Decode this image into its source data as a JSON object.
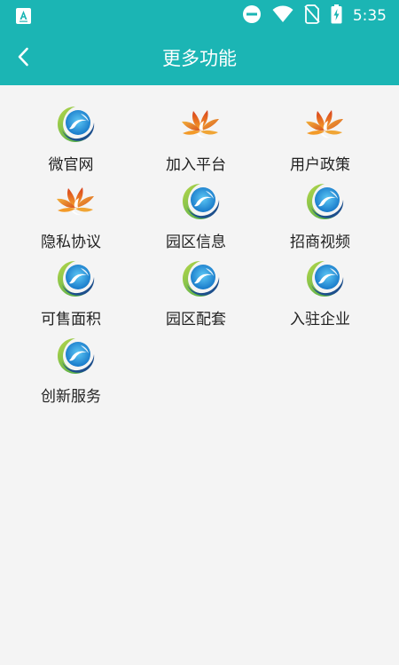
{
  "status_bar": {
    "time": "5:35",
    "icons": [
      "app-notification-icon",
      "do-not-disturb-icon",
      "wifi-icon",
      "no-sim-icon",
      "battery-charging-icon"
    ]
  },
  "header": {
    "title": "更多功能",
    "back_icon": "chevron-left-icon",
    "background_color": "#1bb5b4"
  },
  "features": [
    {
      "label": "微官网",
      "icon": "blue-swirl-logo-icon"
    },
    {
      "label": "加入平台",
      "icon": "orange-flower-logo-icon"
    },
    {
      "label": "用户政策",
      "icon": "orange-flower-logo-icon"
    },
    {
      "label": "隐私协议",
      "icon": "orange-flower-logo-icon"
    },
    {
      "label": "园区信息",
      "icon": "blue-swirl-logo-icon"
    },
    {
      "label": "招商视频",
      "icon": "blue-swirl-logo-icon"
    },
    {
      "label": "可售面积",
      "icon": "blue-swirl-logo-icon"
    },
    {
      "label": "园区配套",
      "icon": "blue-swirl-logo-icon"
    },
    {
      "label": "入驻企业",
      "icon": "blue-swirl-logo-icon"
    },
    {
      "label": "创新服务",
      "icon": "blue-swirl-logo-icon"
    }
  ]
}
